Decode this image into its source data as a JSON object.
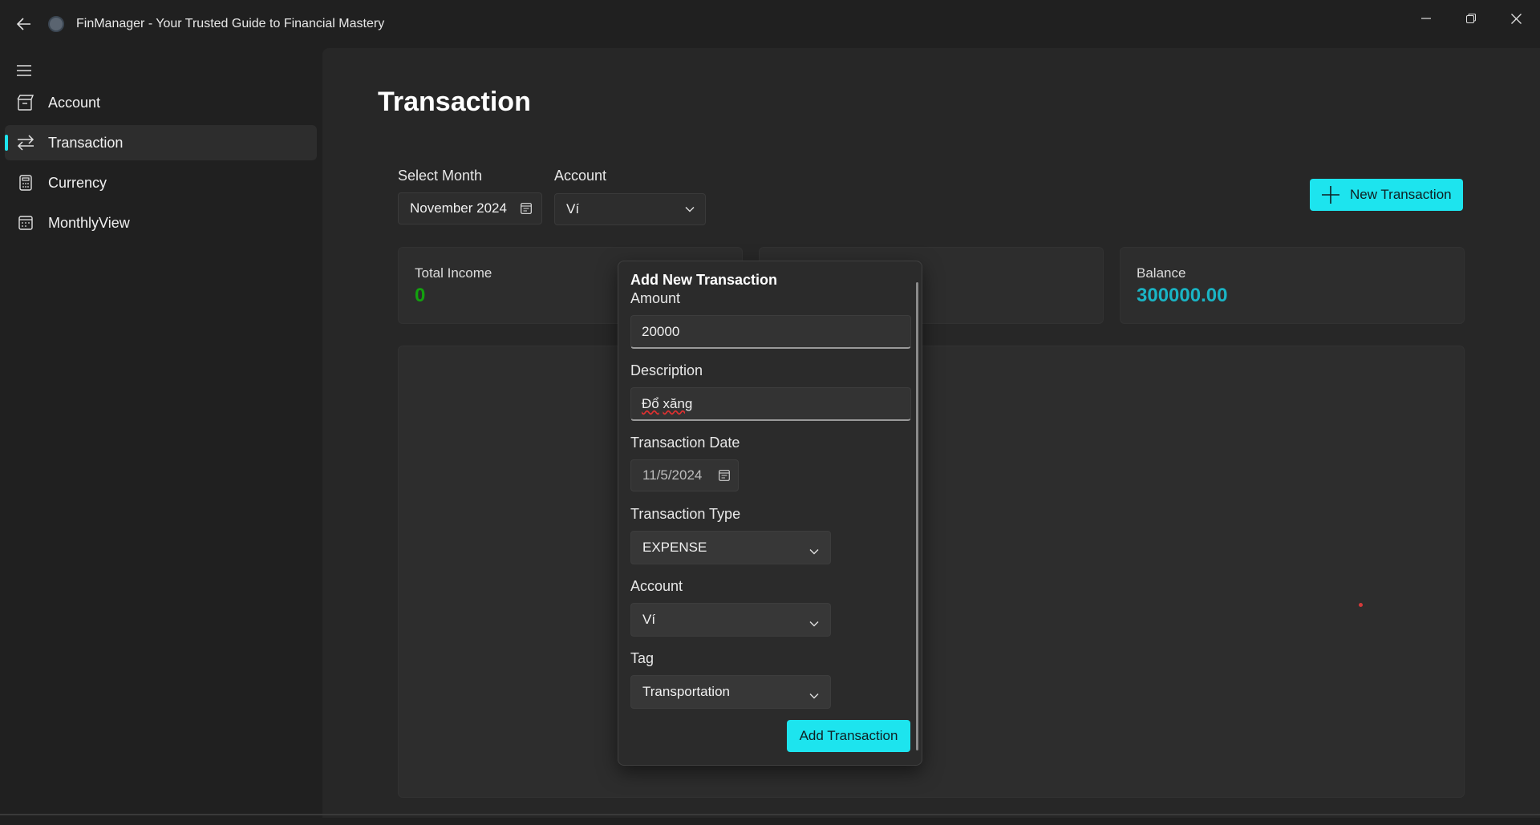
{
  "window": {
    "title": "FinManager - Your Trusted Guide to Financial Mastery"
  },
  "sidebar": {
    "items": [
      {
        "label": "Account",
        "icon": "account-icon",
        "active": false
      },
      {
        "label": "Transaction",
        "icon": "transfer-arrows-icon",
        "active": true
      },
      {
        "label": "Currency",
        "icon": "calculator-icon",
        "active": false
      },
      {
        "label": "MonthlyView",
        "icon": "calendar-icon",
        "active": false
      }
    ]
  },
  "main": {
    "title": "Transaction",
    "filters": {
      "month_label": "Select Month",
      "month_value": "November 2024",
      "account_label": "Account",
      "account_value": "Ví"
    },
    "new_button_label": "New Transaction",
    "cards": [
      {
        "title": "Total Income",
        "value": "0",
        "color": "#13a10e"
      },
      {
        "title": "Balance",
        "value": "300000.00",
        "color": "#1ab4c4"
      }
    ]
  },
  "dialog": {
    "title": "Add New Transaction",
    "amount_label": "Amount",
    "amount_value": "20000",
    "description_label": "Description",
    "description_value_word1": "Đổ",
    "description_value_word2": "xăng",
    "date_label": "Transaction Date",
    "date_value": "11/5/2024",
    "type_label": "Transaction Type",
    "type_value": "EXPENSE",
    "account_label": "Account",
    "account_value": "Ví",
    "tag_label": "Tag",
    "tag_value": "Transportation",
    "submit_label": "Add Transaction"
  },
  "colors": {
    "accent": "#1de4ee",
    "income": "#13a10e",
    "balance": "#1ab4c4"
  }
}
